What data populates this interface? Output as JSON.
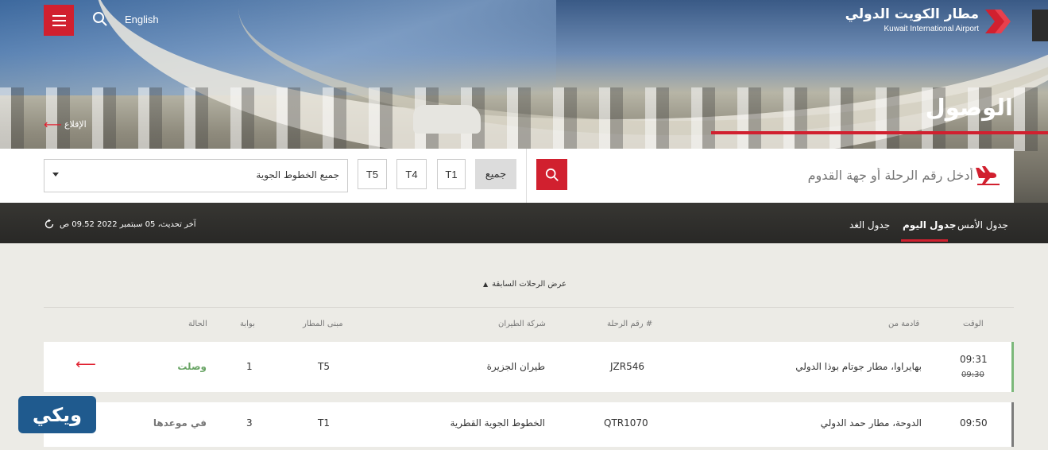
{
  "header": {
    "language_link": "English",
    "logo_ar": "مطار الكويت الدولي",
    "logo_en": "Kuwait International Airport",
    "departures_link": "الإقلاع"
  },
  "page_title": "الوصول",
  "search": {
    "placeholder": "أدخل رقم الرحلة أو جهة القدوم",
    "airline_select_value": "جميع الخطوط الجوية",
    "terminals": [
      "جميع",
      "T1",
      "T4",
      "T5"
    ]
  },
  "day_tabs": {
    "yesterday": "جدول الأمس",
    "today": "جدول اليوم",
    "tomorrow": "جدول الغد"
  },
  "last_update": "آخر تحديث، 05 سبتمبر 2022 09.52 ص",
  "previous_flights": "عرض الرحلات السابقة",
  "table": {
    "headers": {
      "time": "الوقت",
      "origin": "قادمة من",
      "flight_no": "رقم الرحلة #",
      "airline": "شركة الطيران",
      "terminal": "مبنى المطار",
      "gate": "بوابة",
      "status": "الحالة"
    },
    "rows": [
      {
        "time": "09:31",
        "scheduled": "09:30",
        "origin": "بهايراوا، مطار جوتام بوذا الدولي",
        "flight_no": "JZR546",
        "airline": "طيران الجزيرة",
        "terminal": "T5",
        "gate": "1",
        "status": "وصلت"
      },
      {
        "time": "09:50",
        "origin": "الدوحة، مطار حمد الدولي",
        "flight_no": "QTR1070",
        "airline": "الخطوط الجوية القطرية",
        "terminal": "T1",
        "gate": "3",
        "status": "في موعدها"
      }
    ]
  },
  "watermark": "ويكي",
  "colors": {
    "accent_red": "#d1202f",
    "arrived_green": "#6aa566",
    "background": "#ecebe6"
  }
}
